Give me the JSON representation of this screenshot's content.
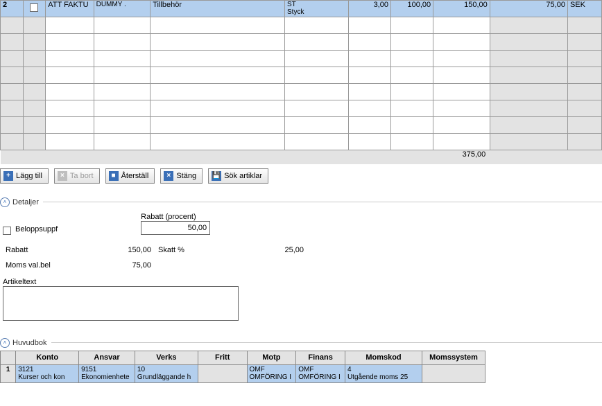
{
  "items": {
    "row1": {
      "line": "2",
      "type": "ATT FAKTU",
      "code": "DUMMY .",
      "desc": "Tillbehör",
      "unit1": "ST",
      "unit2": "Styck",
      "qty": "3,00",
      "price": "100,00",
      "amount": "150,00",
      "vat": "75,00",
      "curr": "SEK"
    },
    "total": "375,00"
  },
  "toolbar": {
    "add": "Lägg till",
    "del": "Ta bort",
    "reset": "Återställ",
    "close": "Stäng",
    "search": "Sök artiklar"
  },
  "sections": {
    "details_title": "Detaljer",
    "ledger_title": "Huvudbok"
  },
  "details": {
    "belopp_label": "Beloppsuppf",
    "rabatt_pct_label": "Rabatt (procent)",
    "rabatt_pct_value": "50,00",
    "rabatt_label": "Rabatt",
    "rabatt_value": "150,00",
    "skatt_label": "Skatt %",
    "skatt_value": "25,00",
    "moms_label": "Moms val.bel",
    "moms_value": "75,00",
    "artikel_label": "Artikeltext",
    "artikel_value": ""
  },
  "ledger": {
    "headers": {
      "konto": "Konto",
      "ansvar": "Ansvar",
      "verks": "Verks",
      "fritt": "Fritt",
      "motp": "Motp",
      "finans": "Finans",
      "momskod": "Momskod",
      "momssystem": "Momssystem"
    },
    "row1": {
      "idx": "1",
      "konto1": "3121",
      "konto2": "Kurser och kon",
      "ansvar1": "9151",
      "ansvar2": "Ekonomienhete",
      "verks1": "10",
      "verks2": "Grundläggande h",
      "fritt1": "",
      "fritt2": "",
      "motp1": "OMF",
      "motp2": "OMFÖRING I",
      "finans1": "OMF",
      "finans2": "OMFÖRING I",
      "momskod1": "4",
      "momskod2": "Utgående moms 25",
      "momssys": ""
    }
  }
}
